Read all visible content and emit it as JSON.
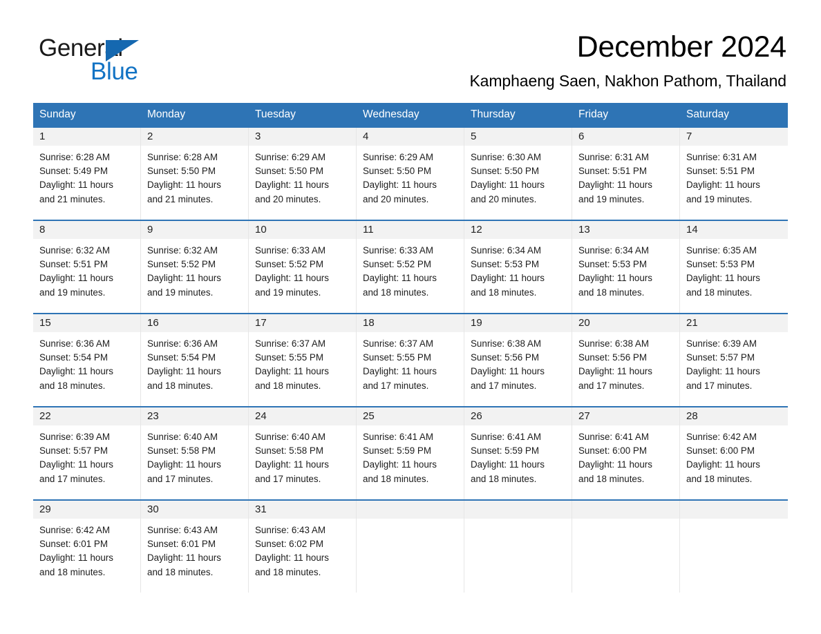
{
  "brand": {
    "word_general": "General",
    "word_blue": "Blue",
    "triangle_color": "#1568b0",
    "blue_color": "#1273c4"
  },
  "header": {
    "month_title": "December 2024",
    "location": "Kamphaeng Saen, Nakhon Pathom, Thailand"
  },
  "calendar": {
    "accent_color": "#2e74b5",
    "daynum_bg": "#f2f2f2",
    "weekdays": [
      "Sunday",
      "Monday",
      "Tuesday",
      "Wednesday",
      "Thursday",
      "Friday",
      "Saturday"
    ],
    "weeks": [
      [
        {
          "day": "1",
          "sunrise": "Sunrise: 6:28 AM",
          "sunset": "Sunset: 5:49 PM",
          "daylight1": "Daylight: 11 hours",
          "daylight2": "and 21 minutes."
        },
        {
          "day": "2",
          "sunrise": "Sunrise: 6:28 AM",
          "sunset": "Sunset: 5:50 PM",
          "daylight1": "Daylight: 11 hours",
          "daylight2": "and 21 minutes."
        },
        {
          "day": "3",
          "sunrise": "Sunrise: 6:29 AM",
          "sunset": "Sunset: 5:50 PM",
          "daylight1": "Daylight: 11 hours",
          "daylight2": "and 20 minutes."
        },
        {
          "day": "4",
          "sunrise": "Sunrise: 6:29 AM",
          "sunset": "Sunset: 5:50 PM",
          "daylight1": "Daylight: 11 hours",
          "daylight2": "and 20 minutes."
        },
        {
          "day": "5",
          "sunrise": "Sunrise: 6:30 AM",
          "sunset": "Sunset: 5:50 PM",
          "daylight1": "Daylight: 11 hours",
          "daylight2": "and 20 minutes."
        },
        {
          "day": "6",
          "sunrise": "Sunrise: 6:31 AM",
          "sunset": "Sunset: 5:51 PM",
          "daylight1": "Daylight: 11 hours",
          "daylight2": "and 19 minutes."
        },
        {
          "day": "7",
          "sunrise": "Sunrise: 6:31 AM",
          "sunset": "Sunset: 5:51 PM",
          "daylight1": "Daylight: 11 hours",
          "daylight2": "and 19 minutes."
        }
      ],
      [
        {
          "day": "8",
          "sunrise": "Sunrise: 6:32 AM",
          "sunset": "Sunset: 5:51 PM",
          "daylight1": "Daylight: 11 hours",
          "daylight2": "and 19 minutes."
        },
        {
          "day": "9",
          "sunrise": "Sunrise: 6:32 AM",
          "sunset": "Sunset: 5:52 PM",
          "daylight1": "Daylight: 11 hours",
          "daylight2": "and 19 minutes."
        },
        {
          "day": "10",
          "sunrise": "Sunrise: 6:33 AM",
          "sunset": "Sunset: 5:52 PM",
          "daylight1": "Daylight: 11 hours",
          "daylight2": "and 19 minutes."
        },
        {
          "day": "11",
          "sunrise": "Sunrise: 6:33 AM",
          "sunset": "Sunset: 5:52 PM",
          "daylight1": "Daylight: 11 hours",
          "daylight2": "and 18 minutes."
        },
        {
          "day": "12",
          "sunrise": "Sunrise: 6:34 AM",
          "sunset": "Sunset: 5:53 PM",
          "daylight1": "Daylight: 11 hours",
          "daylight2": "and 18 minutes."
        },
        {
          "day": "13",
          "sunrise": "Sunrise: 6:34 AM",
          "sunset": "Sunset: 5:53 PM",
          "daylight1": "Daylight: 11 hours",
          "daylight2": "and 18 minutes."
        },
        {
          "day": "14",
          "sunrise": "Sunrise: 6:35 AM",
          "sunset": "Sunset: 5:53 PM",
          "daylight1": "Daylight: 11 hours",
          "daylight2": "and 18 minutes."
        }
      ],
      [
        {
          "day": "15",
          "sunrise": "Sunrise: 6:36 AM",
          "sunset": "Sunset: 5:54 PM",
          "daylight1": "Daylight: 11 hours",
          "daylight2": "and 18 minutes."
        },
        {
          "day": "16",
          "sunrise": "Sunrise: 6:36 AM",
          "sunset": "Sunset: 5:54 PM",
          "daylight1": "Daylight: 11 hours",
          "daylight2": "and 18 minutes."
        },
        {
          "day": "17",
          "sunrise": "Sunrise: 6:37 AM",
          "sunset": "Sunset: 5:55 PM",
          "daylight1": "Daylight: 11 hours",
          "daylight2": "and 18 minutes."
        },
        {
          "day": "18",
          "sunrise": "Sunrise: 6:37 AM",
          "sunset": "Sunset: 5:55 PM",
          "daylight1": "Daylight: 11 hours",
          "daylight2": "and 17 minutes."
        },
        {
          "day": "19",
          "sunrise": "Sunrise: 6:38 AM",
          "sunset": "Sunset: 5:56 PM",
          "daylight1": "Daylight: 11 hours",
          "daylight2": "and 17 minutes."
        },
        {
          "day": "20",
          "sunrise": "Sunrise: 6:38 AM",
          "sunset": "Sunset: 5:56 PM",
          "daylight1": "Daylight: 11 hours",
          "daylight2": "and 17 minutes."
        },
        {
          "day": "21",
          "sunrise": "Sunrise: 6:39 AM",
          "sunset": "Sunset: 5:57 PM",
          "daylight1": "Daylight: 11 hours",
          "daylight2": "and 17 minutes."
        }
      ],
      [
        {
          "day": "22",
          "sunrise": "Sunrise: 6:39 AM",
          "sunset": "Sunset: 5:57 PM",
          "daylight1": "Daylight: 11 hours",
          "daylight2": "and 17 minutes."
        },
        {
          "day": "23",
          "sunrise": "Sunrise: 6:40 AM",
          "sunset": "Sunset: 5:58 PM",
          "daylight1": "Daylight: 11 hours",
          "daylight2": "and 17 minutes."
        },
        {
          "day": "24",
          "sunrise": "Sunrise: 6:40 AM",
          "sunset": "Sunset: 5:58 PM",
          "daylight1": "Daylight: 11 hours",
          "daylight2": "and 17 minutes."
        },
        {
          "day": "25",
          "sunrise": "Sunrise: 6:41 AM",
          "sunset": "Sunset: 5:59 PM",
          "daylight1": "Daylight: 11 hours",
          "daylight2": "and 18 minutes."
        },
        {
          "day": "26",
          "sunrise": "Sunrise: 6:41 AM",
          "sunset": "Sunset: 5:59 PM",
          "daylight1": "Daylight: 11 hours",
          "daylight2": "and 18 minutes."
        },
        {
          "day": "27",
          "sunrise": "Sunrise: 6:41 AM",
          "sunset": "Sunset: 6:00 PM",
          "daylight1": "Daylight: 11 hours",
          "daylight2": "and 18 minutes."
        },
        {
          "day": "28",
          "sunrise": "Sunrise: 6:42 AM",
          "sunset": "Sunset: 6:00 PM",
          "daylight1": "Daylight: 11 hours",
          "daylight2": "and 18 minutes."
        }
      ],
      [
        {
          "day": "29",
          "sunrise": "Sunrise: 6:42 AM",
          "sunset": "Sunset: 6:01 PM",
          "daylight1": "Daylight: 11 hours",
          "daylight2": "and 18 minutes."
        },
        {
          "day": "30",
          "sunrise": "Sunrise: 6:43 AM",
          "sunset": "Sunset: 6:01 PM",
          "daylight1": "Daylight: 11 hours",
          "daylight2": "and 18 minutes."
        },
        {
          "day": "31",
          "sunrise": "Sunrise: 6:43 AM",
          "sunset": "Sunset: 6:02 PM",
          "daylight1": "Daylight: 11 hours",
          "daylight2": "and 18 minutes."
        },
        {
          "day": "",
          "sunrise": "",
          "sunset": "",
          "daylight1": "",
          "daylight2": ""
        },
        {
          "day": "",
          "sunrise": "",
          "sunset": "",
          "daylight1": "",
          "daylight2": ""
        },
        {
          "day": "",
          "sunrise": "",
          "sunset": "",
          "daylight1": "",
          "daylight2": ""
        },
        {
          "day": "",
          "sunrise": "",
          "sunset": "",
          "daylight1": "",
          "daylight2": ""
        }
      ]
    ]
  }
}
